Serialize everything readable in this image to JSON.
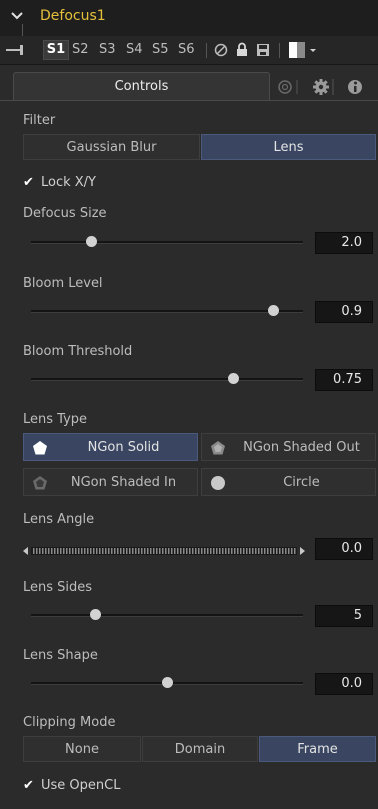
{
  "header": {
    "title": "Defocus1"
  },
  "toolbar": {
    "versions": [
      "S1",
      "S2",
      "S3",
      "S4",
      "S5",
      "S6"
    ]
  },
  "tabs": {
    "controls": "Controls"
  },
  "filter": {
    "label": "Filter",
    "options": [
      "Gaussian Blur",
      "Lens"
    ],
    "selected": "Lens"
  },
  "lock_xy": {
    "label": "Lock X/Y",
    "checked": true
  },
  "defocus_size": {
    "label": "Defocus Size",
    "value": "2.0",
    "position": 0.2
  },
  "bloom_level": {
    "label": "Bloom Level",
    "value": "0.9",
    "position": 0.9
  },
  "bloom_threshold": {
    "label": "Bloom Threshold",
    "value": "0.75",
    "position": 0.75
  },
  "lens_type": {
    "label": "Lens Type",
    "options": [
      "NGon Solid",
      "NGon Shaded Out",
      "NGon Shaded In",
      "Circle"
    ],
    "selected": "NGon Solid"
  },
  "lens_angle": {
    "label": "Lens Angle",
    "value": "0.0"
  },
  "lens_sides": {
    "label": "Lens Sides",
    "value": "5",
    "position": 0.22
  },
  "lens_shape": {
    "label": "Lens Shape",
    "value": "0.0",
    "position": 0.5
  },
  "clipping_mode": {
    "label": "Clipping Mode",
    "options": [
      "None",
      "Domain",
      "Frame"
    ],
    "selected": "Frame"
  },
  "use_opencl": {
    "label": "Use OpenCL",
    "checked": true
  },
  "colors": {
    "title": "#e5c13a",
    "active_button": "#3a4661",
    "background": "#2b2b2b"
  },
  "icons": [
    "collapse-chevron-icon",
    "pin-icon",
    "bypass-icon",
    "lock-icon",
    "save-icon",
    "color-swatch-icon",
    "modifiers-icon",
    "settings-icon",
    "info-icon",
    "pentagon-icon",
    "circle-icon"
  ]
}
